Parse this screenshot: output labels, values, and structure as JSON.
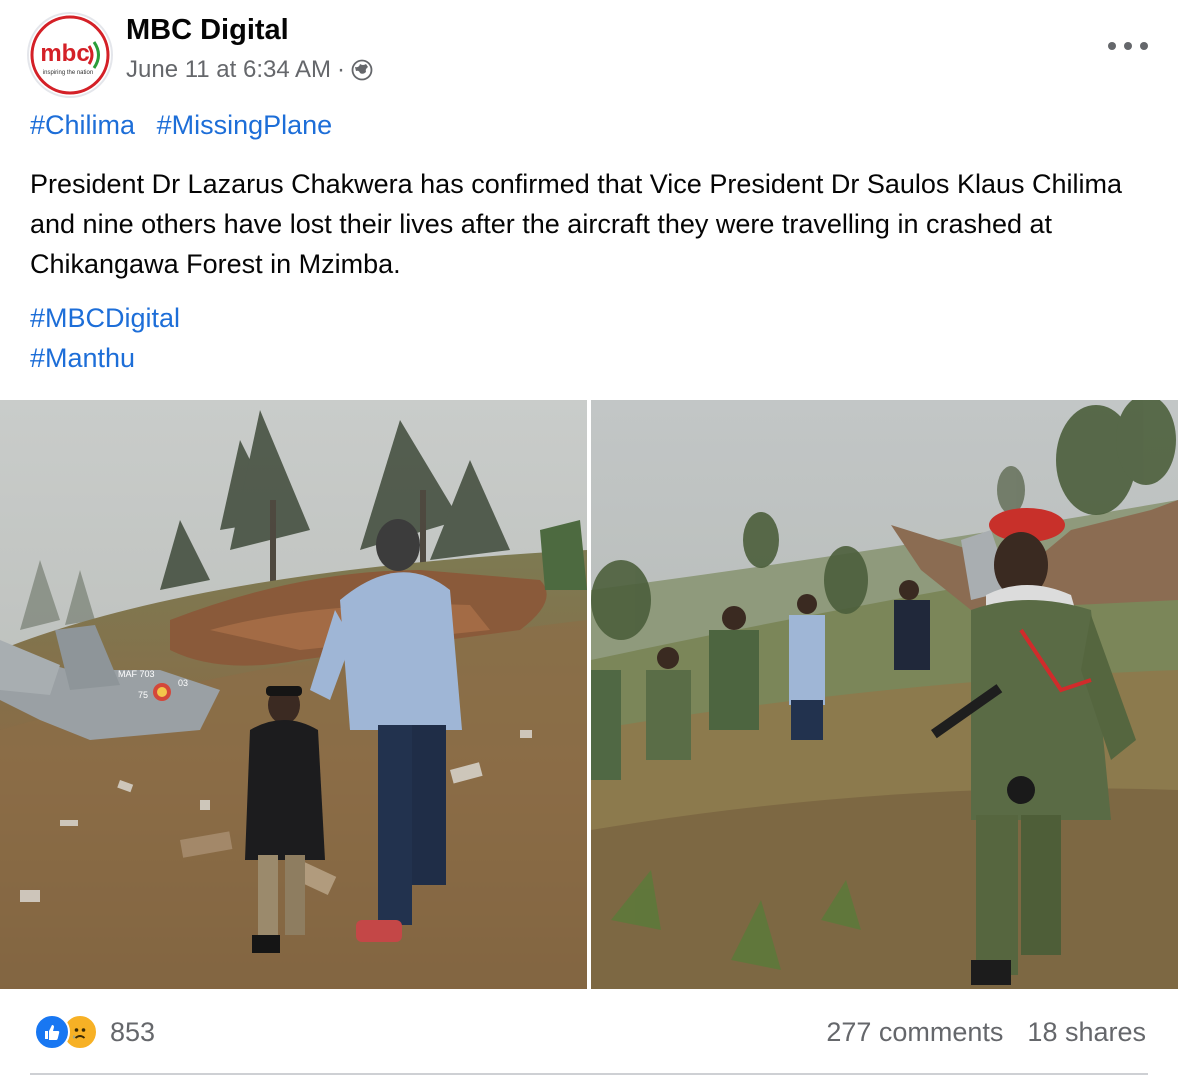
{
  "post": {
    "author": "MBC Digital",
    "timestamp": "June 11 at 6:34 AM",
    "separator": "·",
    "privacy_icon": "globe-icon",
    "logo": {
      "text": "mbc",
      "tagline": "inspiring the nation"
    },
    "hashtags_top": [
      "#Chilima",
      "#MissingPlane"
    ],
    "text": "President Dr Lazarus Chakwera has confirmed that Vice President Dr Saulos Klaus Chilima and nine others have lost their lives after the aircraft they were travelling in crashed at Chikangawa Forest in Mzimba.",
    "hashtags_bottom": [
      "#MBCDigital",
      "#Manthu"
    ],
    "photos": {
      "left": {
        "plane_marking_1": "MAF 703",
        "plane_marking_2": "75",
        "plane_marking_3": "03"
      },
      "right": {}
    }
  },
  "engagement": {
    "reaction_icons": [
      "like-icon",
      "sad-icon"
    ],
    "reaction_count": "853",
    "comments": "277 comments",
    "shares": "18 shares"
  },
  "colors": {
    "link": "#1d6ed8",
    "secondary_text": "#65676b",
    "like_blue": "#1877f2",
    "sad_yellow": "#f7b125",
    "logo_red": "#d42027"
  }
}
